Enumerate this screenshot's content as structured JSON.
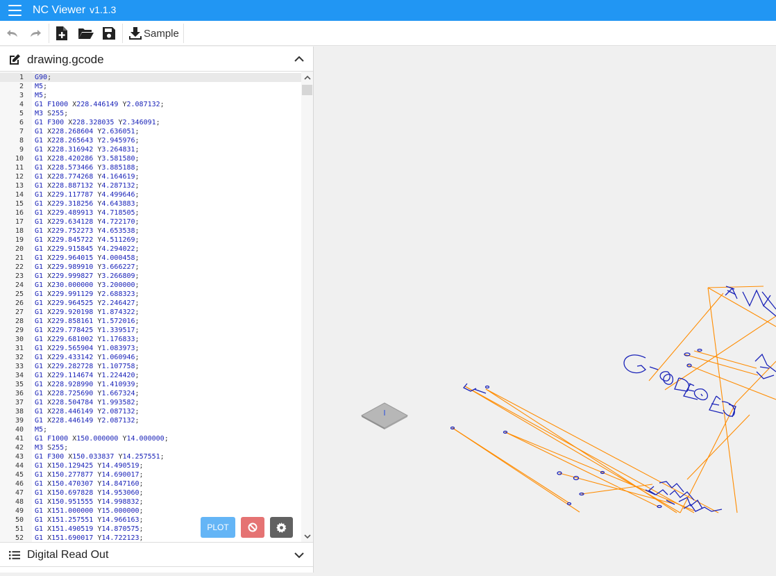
{
  "app": {
    "title": "NC Viewer",
    "version": "v1.1.3"
  },
  "colors": {
    "accent": "#2196f3",
    "plot_button": "#64b5f6",
    "stop_button": "#e57373",
    "settings_button": "#616161",
    "toolpath_cut": "#1a23b8",
    "toolpath_rapid": "#ff8c00"
  },
  "toolbar": {
    "undo_icon": "undo-icon",
    "redo_icon": "redo-icon",
    "new_icon": "new-file-icon",
    "open_icon": "folder-open-icon",
    "save_icon": "save-icon",
    "sample_icon": "download-icon",
    "sample_label": "Sample"
  },
  "editor_panel": {
    "title": "drawing.gcode",
    "edit_icon": "edit-icon",
    "collapse_icon": "chevron-up-icon"
  },
  "gcode_lines": [
    "G90;",
    "M5;",
    "M5;",
    "G1 F1000 X228.446149 Y2.087132;",
    "M3 S255;",
    "G1 F300 X228.328035 Y2.346091;",
    "G1 X228.268604 Y2.636051;",
    "G1 X228.265643 Y2.945976;",
    "G1 X228.316942 Y3.264831;",
    "G1 X228.420286 Y3.581580;",
    "G1 X228.573466 Y3.885188;",
    "G1 X228.774268 Y4.164619;",
    "G1 X228.887132 Y4.287132;",
    "G1 X229.117787 Y4.499646;",
    "G1 X229.318256 Y4.643883;",
    "G1 X229.489913 Y4.718505;",
    "G1 X229.634128 Y4.722170;",
    "G1 X229.752273 Y4.653538;",
    "G1 X229.845722 Y4.511269;",
    "G1 X229.915845 Y4.294022;",
    "G1 X229.964015 Y4.000458;",
    "G1 X229.989910 Y3.666227;",
    "G1 X229.999827 Y3.266809;",
    "G1 X230.000000 Y3.200000;",
    "G1 X229.991129 Y2.688323;",
    "G1 X229.964525 Y2.246427;",
    "G1 X229.920198 Y1.874322;",
    "G1 X229.858161 Y1.572016;",
    "G1 X229.778425 Y1.339517;",
    "G1 X229.681002 Y1.176833;",
    "G1 X229.565904 Y1.083973;",
    "G1 X229.433142 Y1.060946;",
    "G1 X229.282728 Y1.107758;",
    "G1 X229.114674 Y1.224420;",
    "G1 X228.928990 Y1.410939;",
    "G1 X228.725690 Y1.667324;",
    "G1 X228.504784 Y1.993582;",
    "G1 X228.446149 Y2.087132;",
    "G1 X228.446149 Y2.087132;",
    "M5;",
    "G1 F1000 X150.000000 Y14.000000;",
    "M3 S255;",
    "G1 F300 X150.033837 Y14.257551;",
    "G1 X150.129425 Y14.490519;",
    "G1 X150.277877 Y14.690017;",
    "G1 X150.470307 Y14.847160;",
    "G1 X150.697828 Y14.953060;",
    "G1 X150.951555 Y14.998832;",
    "G1 X151.000000 Y15.000000;",
    "G1 X151.257551 Y14.966163;",
    "G1 X151.490519 Y14.870575;",
    "G1 X151.690017 Y14.722123;"
  ],
  "line_numbers": [
    "1",
    "2",
    "3",
    "4",
    "5",
    "6",
    "7",
    "8",
    "9",
    "10",
    "11",
    "12",
    "13",
    "14",
    "15",
    "16",
    "17",
    "18",
    "19",
    "20",
    "21",
    "22",
    "23",
    "24",
    "25",
    "26",
    "27",
    "28",
    "29",
    "30",
    "31",
    "32",
    "33",
    "34",
    "35",
    "36",
    "37",
    "38",
    "39",
    "40",
    "41",
    "42",
    "43",
    "44",
    "45",
    "46",
    "47",
    "48",
    "49",
    "50",
    "51",
    "52"
  ],
  "buttons": {
    "plot_label": "PLOT",
    "stop_icon": "block-icon",
    "settings_icon": "gear-icon"
  },
  "dro_panel": {
    "title": "Digital Read Out",
    "list_icon": "list-icon",
    "expand_icon": "chevron-down-icon"
  },
  "viewport": {
    "axis_gizmo_label": "I",
    "engraved_text": "G-CODE"
  }
}
